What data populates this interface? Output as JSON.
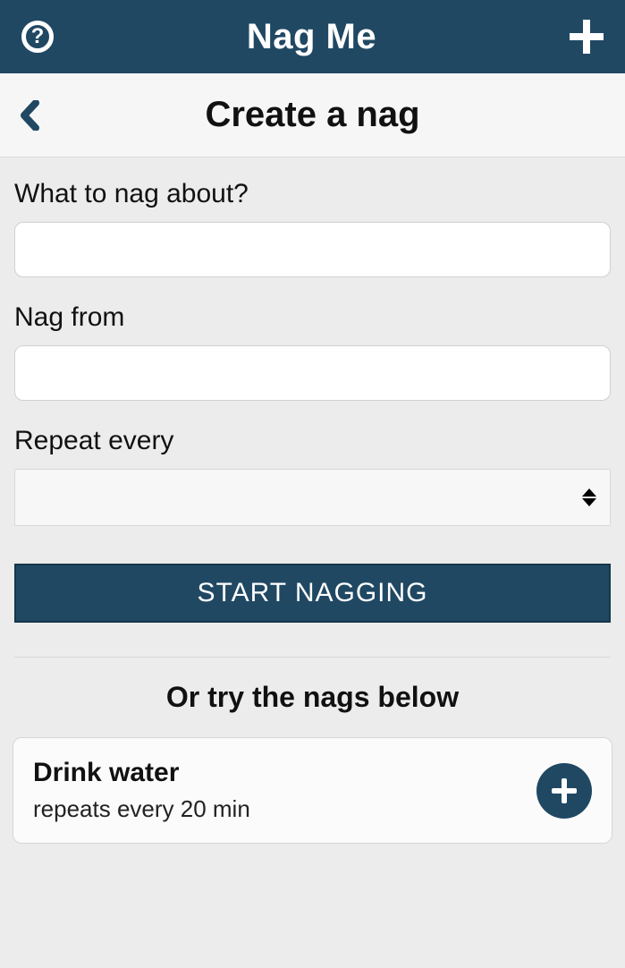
{
  "topbar": {
    "title": "Nag Me"
  },
  "subheader": {
    "title": "Create a nag"
  },
  "form": {
    "about_label": "What to nag about?",
    "about_value": "",
    "from_label": "Nag from",
    "from_value": "",
    "repeat_label": "Repeat every",
    "repeat_value": "",
    "submit_label": "START NAGGING"
  },
  "suggestions": {
    "heading": "Or try the nags below",
    "items": [
      {
        "title": "Drink water",
        "subtitle": "repeats every 20 min"
      }
    ]
  }
}
